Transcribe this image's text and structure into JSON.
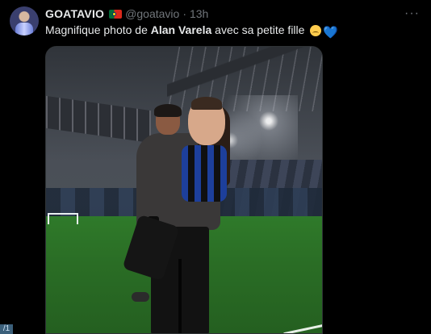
{
  "tweet": {
    "display_name": "GOATAVIO",
    "handle": "@goatavio",
    "separator": "·",
    "time": "13h",
    "more": "···",
    "text_before": "Magnifique photo de ",
    "text_bold": "Alan Varela",
    "text_after": " avec sa petite fille ",
    "emojis": [
      "pleading-face",
      "blue-heart"
    ],
    "heart": "💙"
  },
  "media": {
    "kind": "photo",
    "subject": "man holding child on stadium pitch at night"
  },
  "pager": "/1",
  "colors": {
    "background": "#000000",
    "text": "#e7e9ea",
    "muted": "#71767b",
    "heart": "#5dadec"
  }
}
